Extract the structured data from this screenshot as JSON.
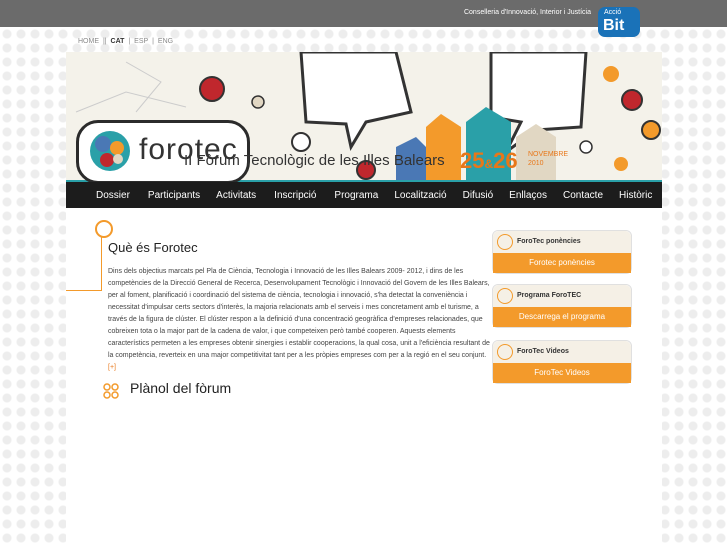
{
  "header": {
    "ministry": "Conselleria d'Innovació, Interior i Justícia",
    "logo_small": "Acció",
    "logo_big": "Bit"
  },
  "lang_bar": {
    "home": "HOME",
    "sep1": "||",
    "cat": "CAT",
    "sep2": "|",
    "esp": "ESP",
    "sep3": "|",
    "eng": "ENG"
  },
  "brand": {
    "logo_text": "forotec",
    "forum_title": "II Fòrum Tecnològic de les Illes Balears",
    "date_start": "25",
    "date_amp": "&",
    "date_end": "26",
    "month": "NOVEMBRE",
    "year": "2010"
  },
  "nav": {
    "items": [
      {
        "label": "Dossier"
      },
      {
        "label": "Participants"
      },
      {
        "label": "Activitats"
      },
      {
        "label": "Inscripció"
      },
      {
        "label": "Programa"
      },
      {
        "label": "Localització"
      },
      {
        "label": "Difusió"
      },
      {
        "label": "Enllaços"
      },
      {
        "label": "Contacte"
      },
      {
        "label": "Històric"
      }
    ]
  },
  "main": {
    "heading": "Què és Forotec",
    "body": "Dins dels objectius marcats pel Pla de Ciència, Tecnologia i Innovació de les Illes Balears 2009- 2012, i dins de les competències de la Direcció General de Recerca, Desenvolupament Tecnològic i Innovació del Govern de les Illes Balears, per al foment, planificació i coordinació del sistema de ciència, tecnologia i innovació, s'ha detectat la conveniència i necessitat d'impulsar certs sectors d'interès, la majoria relacionats amb el serveis i mes concretament amb el turisme, a través de la figura de clúster. El clúster respon a la definició d'una concentració geogràfica d'empreses relacionades, que cobreixen tota o la major part de la cadena de valor, i que competeixen però també cooperen. Aquests elements característics permeten a les empreses obtenir sinergies i establir cooperacions, la qual cosa, unit a l'eficiència resultant de la competència, reverteix en una major competitivitat tant per a les pròpies empreses com per a la regió en el seu conjunt.",
    "more": "[+]",
    "planol_heading": "Plànol del fòrum"
  },
  "sidebar": {
    "boxes": [
      {
        "title": "ForoTec ponències",
        "button": "Forotec ponències"
      },
      {
        "title": "Programa ForoTEC",
        "button": "Descarrega el programa"
      },
      {
        "title": "ForoTec Videos",
        "button": "ForoTec Videos"
      }
    ]
  },
  "colors": {
    "accent": "#f39a2b",
    "teal": "#2aa0a8",
    "nav_bg": "#1c1c1c",
    "topbar": "#6b6b6b",
    "date": "#e87719"
  }
}
